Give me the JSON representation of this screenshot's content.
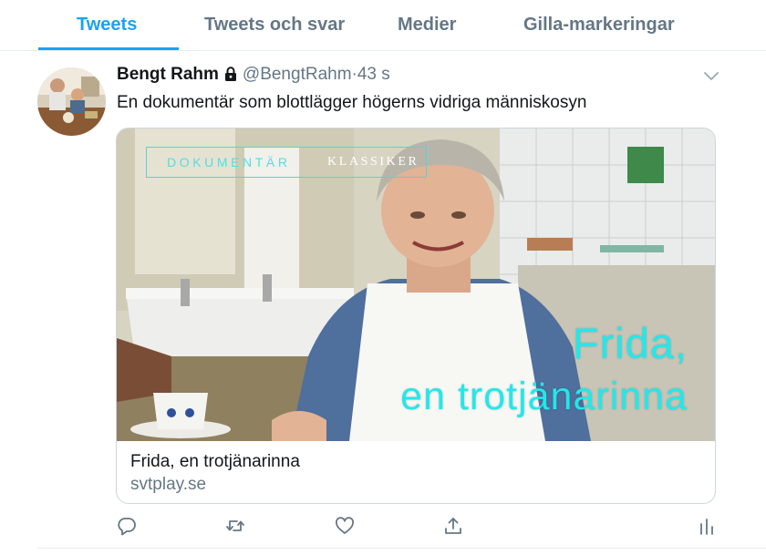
{
  "tabs": [
    {
      "label": "Tweets",
      "active": true
    },
    {
      "label": "Tweets och svar",
      "active": false
    },
    {
      "label": "Medier",
      "active": false
    },
    {
      "label": "Gilla-markeringar",
      "active": false
    }
  ],
  "tweet": {
    "author_name": "Bengt Rahm",
    "protected_icon": "lock-icon",
    "handle": "@BengtRahm",
    "separator": "·",
    "time": "43 s",
    "text": "En dokumentär som blottlägger högerns vidriga människosyn",
    "card": {
      "image_brand_part1": "DOKUMENTÄR",
      "image_brand_part2": "KLASSIKER",
      "image_title_line1": "Frida,",
      "image_title_line2": "en trotjänarinna",
      "title": "Frida, en trotjänarinna",
      "domain": "svtplay.se"
    },
    "actions": [
      "reply-icon",
      "retweet-icon",
      "like-icon",
      "share-icon",
      "analytics-icon"
    ]
  },
  "colors": {
    "accent": "#1da1f2",
    "secondary_text": "#657786",
    "divider": "#e6ecf0",
    "overlay_text": "#22e8ea"
  }
}
